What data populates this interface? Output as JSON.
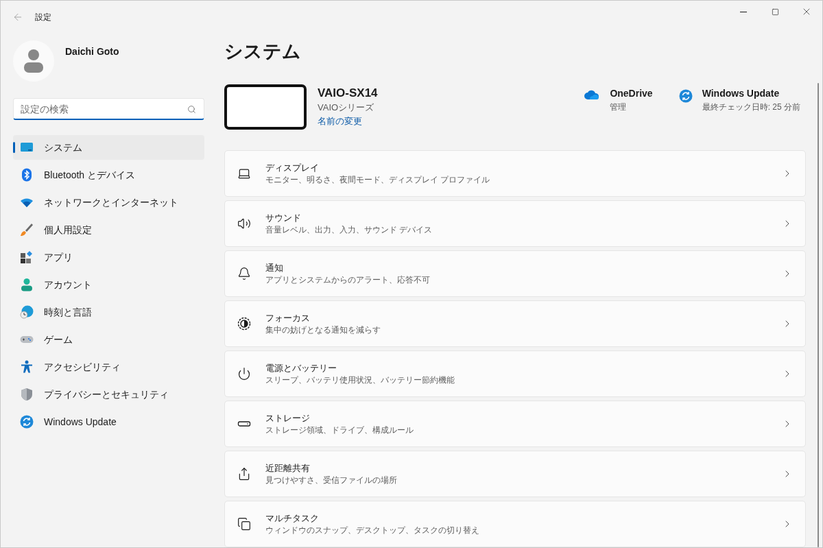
{
  "window": {
    "title": "設定"
  },
  "user": {
    "name": "Daichi Goto"
  },
  "search": {
    "placeholder": "設定の検索",
    "focused": true
  },
  "nav": [
    {
      "label": "システム",
      "kind": "system",
      "selected": true
    },
    {
      "label": "Bluetooth とデバイス",
      "kind": "bluetooth",
      "selected": false
    },
    {
      "label": "ネットワークとインターネット",
      "kind": "network",
      "selected": false
    },
    {
      "label": "個人用設定",
      "kind": "personalize",
      "selected": false
    },
    {
      "label": "アプリ",
      "kind": "apps",
      "selected": false
    },
    {
      "label": "アカウント",
      "kind": "account",
      "selected": false
    },
    {
      "label": "時刻と言語",
      "kind": "time",
      "selected": false
    },
    {
      "label": "ゲーム",
      "kind": "gaming",
      "selected": false
    },
    {
      "label": "アクセシビリティ",
      "kind": "accessibility",
      "selected": false
    },
    {
      "label": "プライバシーとセキュリティ",
      "kind": "privacy",
      "selected": false
    },
    {
      "label": "Windows Update",
      "kind": "update",
      "selected": false
    }
  ],
  "page_title": "システム",
  "device": {
    "name": "VAIO-SX14",
    "model": "VAIOシリーズ",
    "rename_link": "名前の変更"
  },
  "status": [
    {
      "title": "OneDrive",
      "subtitle": "管理",
      "kind": "cloud"
    },
    {
      "title": "Windows Update",
      "subtitle": "最終チェック日時: 25 分前",
      "kind": "update"
    }
  ],
  "settings": [
    {
      "title": "ディスプレイ",
      "description": "モニター、明るさ、夜間モード、ディスプレイ プロファイル",
      "kind": "display"
    },
    {
      "title": "サウンド",
      "description": "音量レベル、出力、入力、サウンド デバイス",
      "kind": "sound"
    },
    {
      "title": "通知",
      "description": "アプリとシステムからのアラート、応答不可",
      "kind": "notifications"
    },
    {
      "title": "フォーカス",
      "description": "集中の妨げとなる通知を減らす",
      "kind": "focus"
    },
    {
      "title": "電源とバッテリー",
      "description": "スリープ、バッテリ使用状況、バッテリー節約機能",
      "kind": "power"
    },
    {
      "title": "ストレージ",
      "description": "ストレージ領域、ドライブ、構成ルール",
      "kind": "storage"
    },
    {
      "title": "近距離共有",
      "description": "見つけやすさ、受信ファイルの場所",
      "kind": "share"
    },
    {
      "title": "マルチタスク",
      "description": "ウィンドウのスナップ、デスクトップ、タスクの切り替え",
      "kind": "multitask"
    }
  ]
}
